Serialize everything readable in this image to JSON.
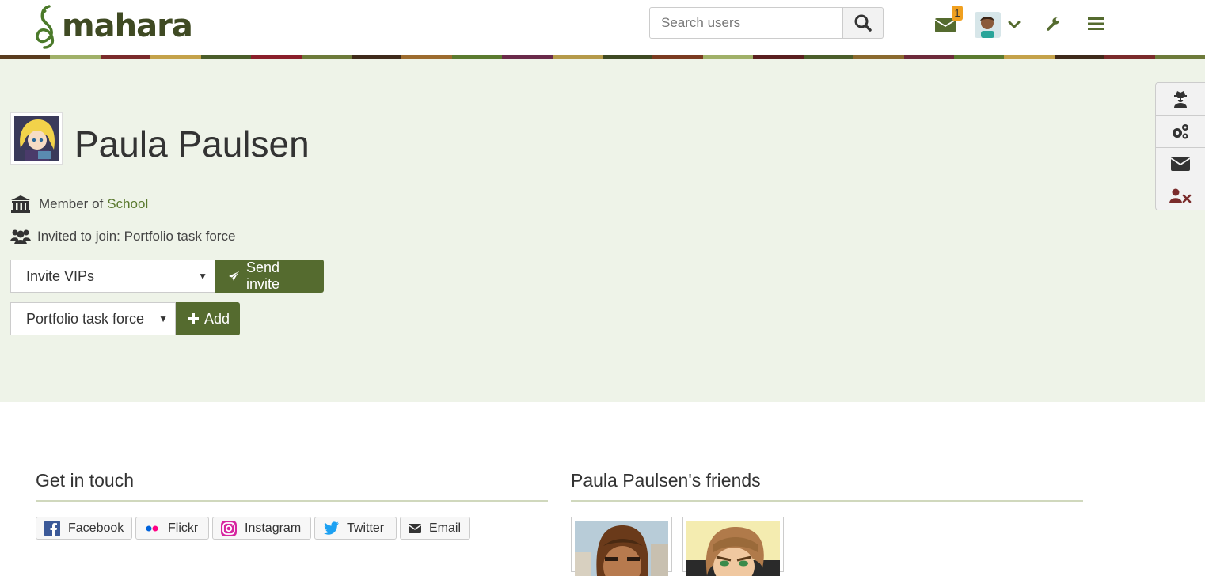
{
  "header": {
    "logo_text": "mahara",
    "search_placeholder": "Search users",
    "inbox_count": "1",
    "icons": [
      "search-icon",
      "envelope-icon",
      "chevron-down-icon",
      "wrench-icon",
      "hamburger-icon"
    ]
  },
  "profile": {
    "name": "Paula Paulsen",
    "member_prefix": "Member of",
    "member_institution": "School",
    "invited_text": "Invited to join: Portfolio task force",
    "invite_select_value": "Invite VIPs",
    "send_invite_label": "Send invite",
    "group_select_value": "Portfolio task force",
    "add_label": "Add"
  },
  "sidebar_actions": [
    "masquerade-icon",
    "cogs-icon",
    "send-message-icon",
    "remove-user-icon"
  ],
  "get_in_touch": {
    "title": "Get in touch",
    "links": [
      {
        "label": "Facebook",
        "icon": "facebook-icon",
        "color": "#3b5998"
      },
      {
        "label": "Flickr",
        "icon": "flickr-icon",
        "color": "#ff0084"
      },
      {
        "label": "Instagram",
        "icon": "instagram-icon",
        "color": "#d6249f"
      },
      {
        "label": "Twitter",
        "icon": "twitter-icon",
        "color": "#1da1f2"
      },
      {
        "label": "Email",
        "icon": "envelope-icon",
        "color": "#333333"
      }
    ]
  },
  "friends": {
    "title": "Paula Paulsen's friends"
  },
  "colors": {
    "accent": "#556b2f",
    "hero_bg": "#eef3e8",
    "link": "#5b7a2f",
    "badge": "#f0a020",
    "danger": "#7a2b2b"
  }
}
